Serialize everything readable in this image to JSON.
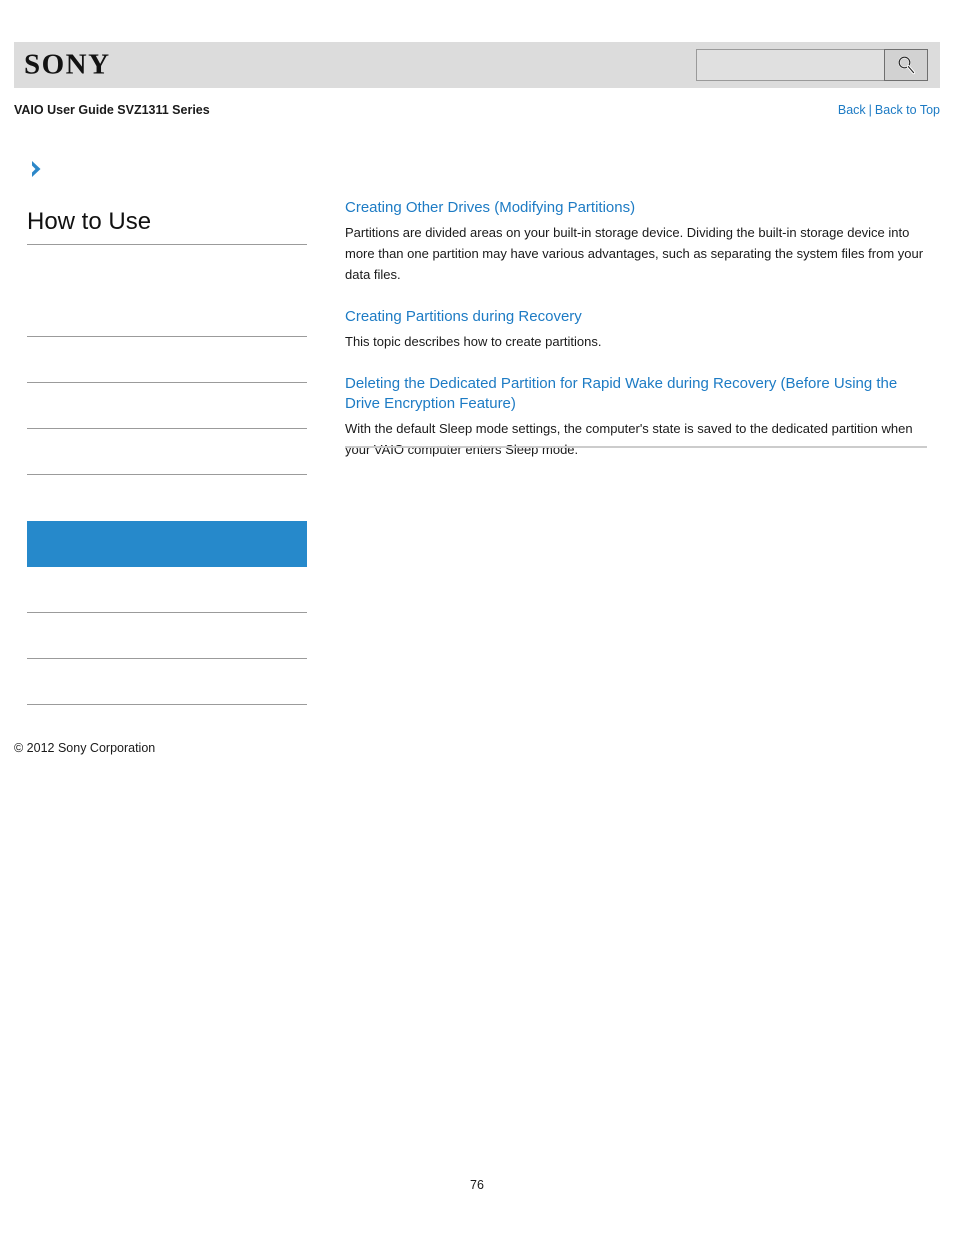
{
  "header": {
    "logo_text": "SONY",
    "search": {
      "value": "",
      "placeholder": "",
      "icon": "search-icon",
      "button_label": ""
    }
  },
  "titlebar": {
    "guide_title": "VAIO User Guide SVZ1311 Series",
    "back_label": "Back",
    "separator": "|",
    "back_to_top_label": "Back to Top"
  },
  "sidebar": {
    "arrow_icon": "chevron-right-icon",
    "heading": "How to Use",
    "items": [
      {
        "label": ""
      },
      {
        "label": ""
      },
      {
        "label": ""
      },
      {
        "label": ""
      },
      {
        "label": ""
      },
      {
        "label": ""
      },
      {
        "label": "",
        "selected": true
      },
      {
        "label": ""
      },
      {
        "label": ""
      },
      {
        "label": ""
      }
    ],
    "copyright": "© 2012 Sony Corporation"
  },
  "content": {
    "topics": [
      {
        "link": "Creating Other Drives (Modifying Partitions)",
        "description": "Partitions are divided areas on your built-in storage device. Dividing the built-in storage device into more than one partition may have various advantages, such as separating the system files from your data files."
      },
      {
        "link": "Creating Partitions during Recovery",
        "description": "This topic describes how to create partitions."
      },
      {
        "link": "Deleting the Dedicated Partition for Rapid Wake during Recovery (Before Using the Drive Encryption Feature)",
        "description": "With the default Sleep mode settings, the computer's state is saved to the dedicated partition when your VAIO computer enters Sleep mode."
      }
    ]
  },
  "footer": {
    "page_number": "76"
  },
  "colors": {
    "accent_blue": "#2689cb",
    "link_blue": "#1d7bc4",
    "header_gray": "#dcdcdc",
    "rule_gray": "#9b9b9b"
  }
}
